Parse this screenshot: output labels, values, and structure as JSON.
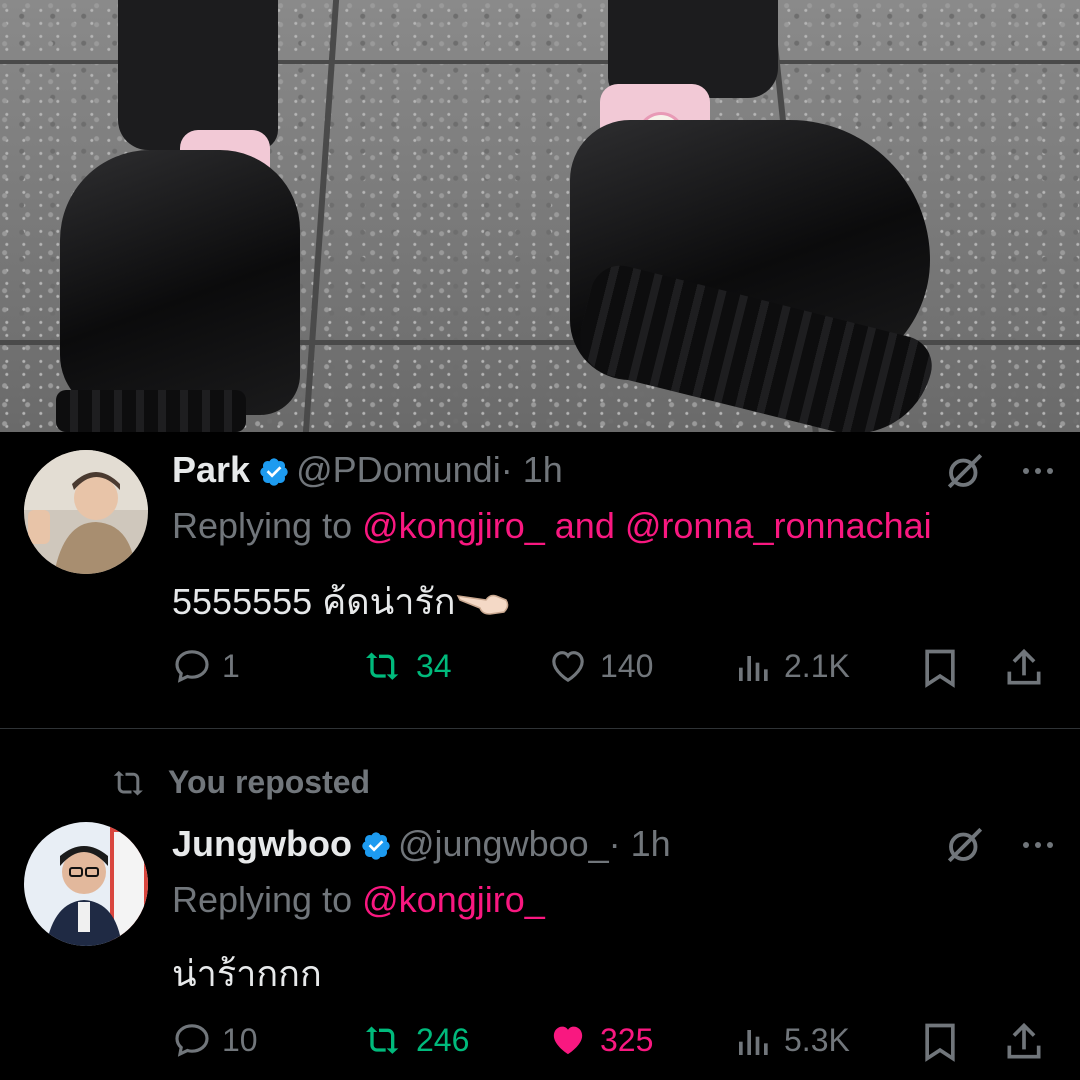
{
  "tweets": [
    {
      "name": "Park",
      "handle": "@PDomundi",
      "time": "· 1h",
      "replying_prefix": "Replying to",
      "mention1": "@kongjiro_",
      "joiner": "and",
      "mention2": "@ronna_ronnachai",
      "text": "5555555 ค้ดน่ารัก",
      "emoji": "hand-pointing-left-emoji",
      "replies": "1",
      "reposts": "34",
      "likes": "140",
      "views": "2.1K",
      "reposted_by_you": true,
      "liked": false
    },
    {
      "social_context": "You reposted",
      "name": "Jungwboo",
      "handle": "@jungwboo_",
      "time": "· 1h",
      "replying_prefix": "Replying to",
      "mention1": "@kongjiro_",
      "text": "น่าร้ากกก",
      "replies": "10",
      "reposts": "246",
      "likes": "325",
      "views": "5.3K",
      "reposted_by_you": true,
      "liked": true
    }
  ],
  "icons": {
    "verified": "verified-badge-icon",
    "grok": "grok-icon",
    "more": "more-options-icon",
    "reply": "reply-icon",
    "repost": "repost-icon",
    "like": "like-heart-icon",
    "views": "views-chart-icon",
    "bookmark": "bookmark-icon",
    "share": "share-icon"
  },
  "colors": {
    "background": "#000000",
    "text": "#e7e9ea",
    "muted": "#71767b",
    "mention": "#f91880",
    "repost_active": "#00ba7c",
    "like_active": "#f91880",
    "verified": "#1d9bf0"
  }
}
